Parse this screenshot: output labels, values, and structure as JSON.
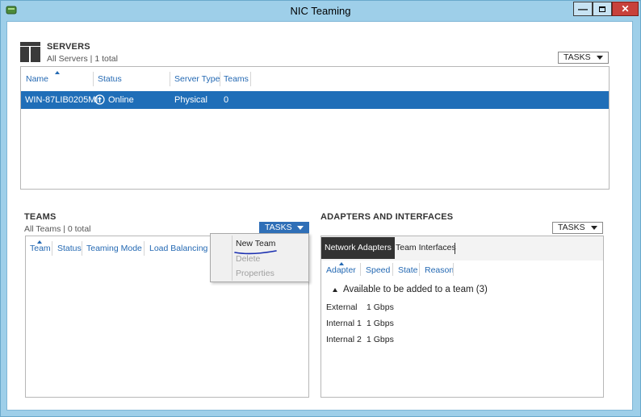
{
  "window": {
    "title": "NIC Teaming"
  },
  "servers": {
    "title": "SERVERS",
    "subtitle": "All Servers | 1 total",
    "tasks_label": "TASKS",
    "columns": [
      "Name",
      "Status",
      "Server Type",
      "Teams"
    ],
    "rows": [
      {
        "name": "WIN-87LIB0205MI",
        "status": "Online",
        "server_type": "Physical",
        "teams": "0"
      }
    ]
  },
  "teams": {
    "title": "TEAMS",
    "subtitle": "All Teams | 0 total",
    "tasks_label": "TASKS",
    "columns": [
      "Team",
      "Status",
      "Teaming Mode",
      "Load Balancing"
    ],
    "menu": {
      "new_team": "New Team",
      "delete": "Delete",
      "properties": "Properties"
    }
  },
  "adapters": {
    "title": "ADAPTERS AND INTERFACES",
    "tasks_label": "TASKS",
    "tabs": [
      "Network Adapters",
      "Team Interfaces"
    ],
    "columns": [
      "Adapter",
      "Speed",
      "State",
      "Reason"
    ],
    "group_label": "Available to be added to a team (3)",
    "rows": [
      {
        "adapter": "External",
        "speed": "1 Gbps"
      },
      {
        "adapter": "Internal 1",
        "speed": "1 Gbps"
      },
      {
        "adapter": "Internal 2",
        "speed": "1 Gbps"
      }
    ]
  },
  "colors": {
    "selection": "#1f6eb8",
    "header_link": "#2469b3",
    "title_bar": "#9ecfe9",
    "close": "#c8413b"
  }
}
